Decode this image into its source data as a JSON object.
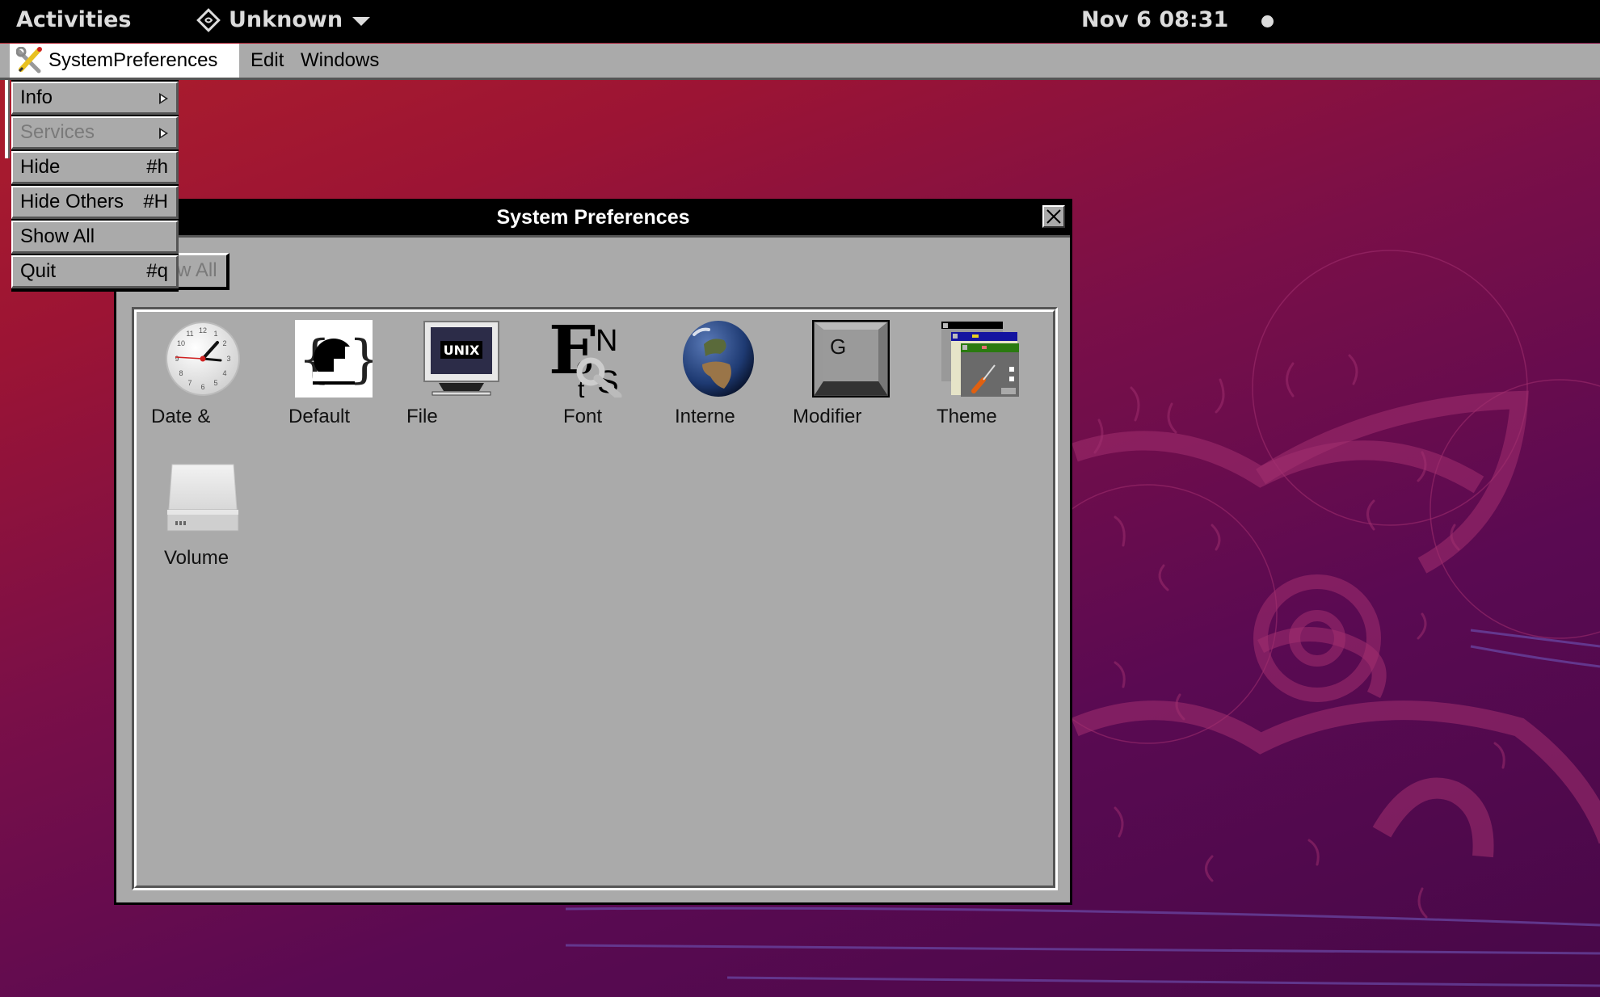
{
  "topbar": {
    "activities": "Activities",
    "app_name": "Unknown",
    "app_icon": "app-diamond-icon",
    "clock": "Nov 6 08:31",
    "status_indicator": "status-dot"
  },
  "menubar": {
    "app_menu": "SystemPreferences",
    "app_menu_icon": "tools-icon",
    "items": [
      {
        "label": "Edit"
      },
      {
        "label": "Windows"
      }
    ]
  },
  "app_menu_dropdown": {
    "items": [
      {
        "label": "Info",
        "shortcut": "",
        "submenu": true,
        "enabled": true
      },
      {
        "label": "Services",
        "shortcut": "",
        "submenu": true,
        "enabled": false
      },
      {
        "label": "Hide",
        "shortcut": "#h",
        "submenu": false,
        "enabled": true
      },
      {
        "label": "Hide Others",
        "shortcut": "#H",
        "submenu": false,
        "enabled": true
      },
      {
        "label": "Show All",
        "shortcut": "",
        "submenu": false,
        "enabled": true
      },
      {
        "label": "Quit",
        "shortcut": "#q",
        "submenu": false,
        "enabled": true
      }
    ]
  },
  "window": {
    "title": "System Preferences",
    "show_all_button": "Show All",
    "show_all_enabled": false,
    "preferences": [
      {
        "label": "Date &",
        "icon": "clock-icon"
      },
      {
        "label": "Default",
        "icon": "defaults-icon"
      },
      {
        "label": "File",
        "icon": "unix-monitor-icon"
      },
      {
        "label": "Font",
        "icon": "fonts-icon"
      },
      {
        "label": "Interne",
        "icon": "globe-icon"
      },
      {
        "label": "Modifier",
        "icon": "keyboard-key-icon"
      },
      {
        "label": "Theme",
        "icon": "theme-windows-icon"
      },
      {
        "label": "Volume",
        "icon": "drive-icon"
      }
    ],
    "modifier_key_letter": "G",
    "unix_label": "UNIX"
  },
  "colors": {
    "topbar_bg": "#000000",
    "menubar_bg": "#aaaaaa",
    "window_bg": "#aaaaaa",
    "disabled_text": "#7a7a7a",
    "wallpaper_top": "#b0202a",
    "wallpaper_bottom": "#470848"
  }
}
